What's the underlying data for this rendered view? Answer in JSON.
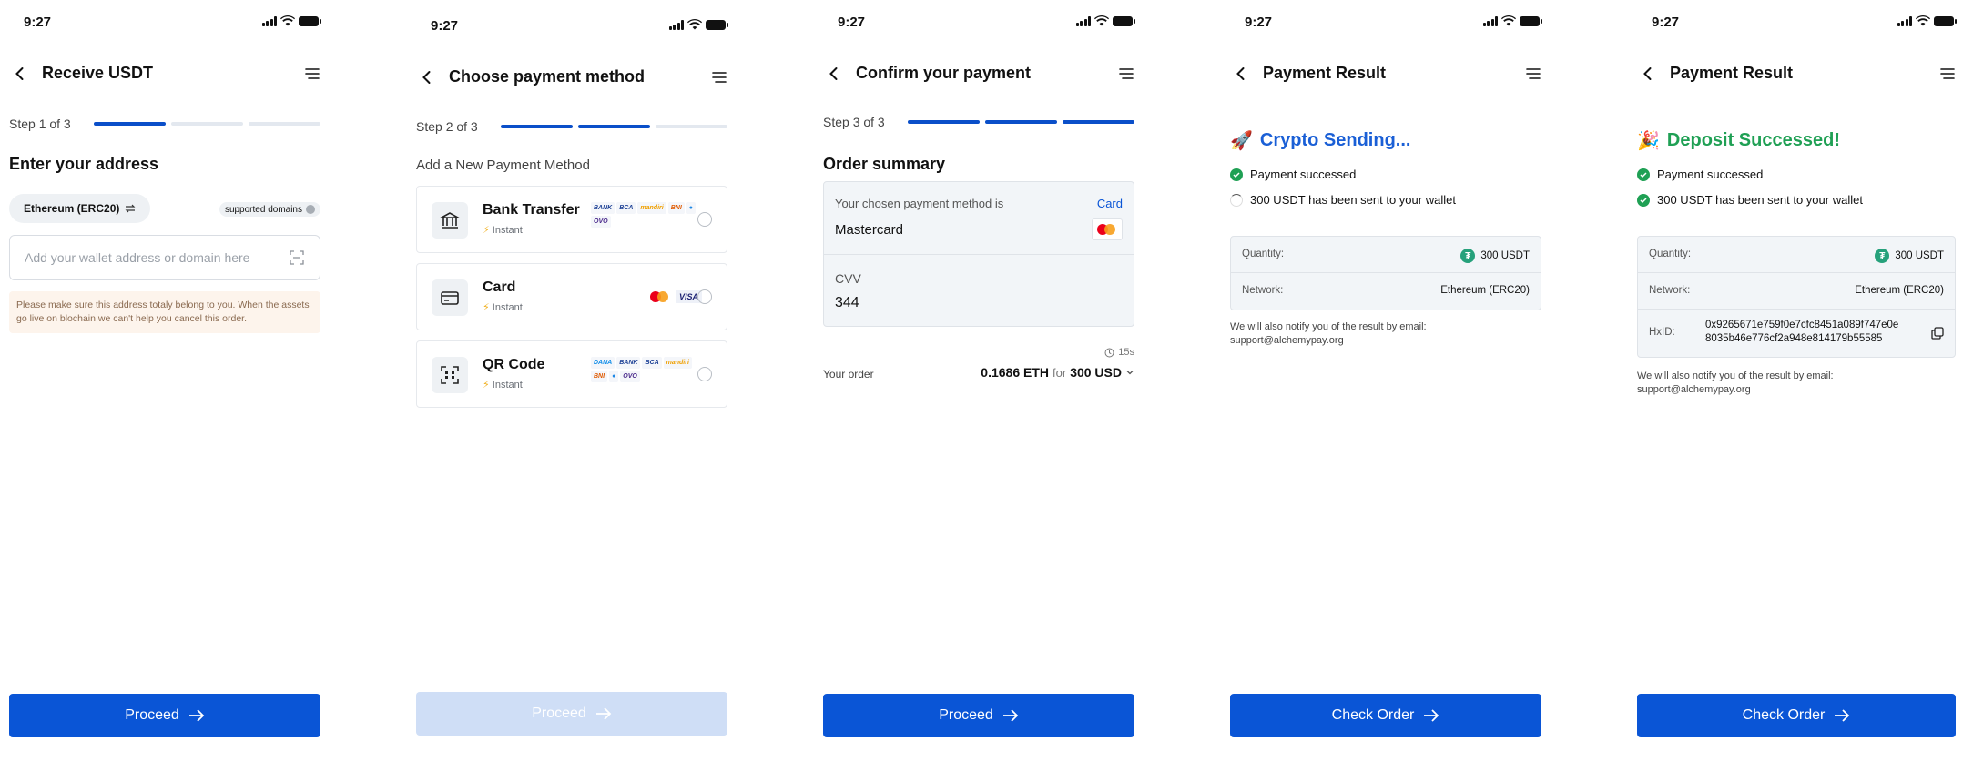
{
  "status_time": "9:27",
  "common": {
    "step_prefix": "Step",
    "proceed_label": "Proceed",
    "check_order_label": "Check Order",
    "quantity_label": "Quantity:",
    "quantity_value": "300 USDT",
    "network_label": "Network:",
    "network_value": "Ethereum (ERC20)",
    "notify_text": "We will also notify you of the result by email:",
    "notify_email": "support@alchemypay.org",
    "payment_success": "Payment successed",
    "sent_to_wallet": "300 USDT has been sent to your wallet"
  },
  "screen1": {
    "title": "Receive USDT",
    "step": "Step 1 of 3",
    "heading": "Enter your address",
    "network_chip": "Ethereum (ERC20)",
    "supported": "supported domains",
    "address_placeholder": "Add your wallet address or domain here",
    "warning": "Please make sure this address totaly belong to you. When the assets go live on blochain we can't help you cancel this order.",
    "proceed": "Proceed"
  },
  "screen2": {
    "title": "Choose payment method",
    "step": "Step 2 of 3",
    "subtitle": "Add a New Payment Method",
    "methods": [
      {
        "name": "Bank Transfer",
        "speed": "Instant",
        "logos": [
          "BANK",
          "BCA",
          "mandiri",
          "BNI",
          "●",
          "OVO"
        ]
      },
      {
        "name": "Card",
        "speed": "Instant",
        "logos": [
          "VISA"
        ]
      },
      {
        "name": "QR Code",
        "speed": "Instant",
        "logos": [
          "DANA",
          "BANK",
          "BCA",
          "mandiri",
          "BNI",
          "●",
          "OVO"
        ]
      }
    ],
    "proceed": "Proceed"
  },
  "screen3": {
    "title": "Confirm your payment",
    "step": "Step 3 of 3",
    "heading": "Order summary",
    "chosen_label": "Your chosen payment method is",
    "card_link": "Card",
    "card_name": "Mastercard",
    "cvv_label": "CVV",
    "cvv_value": "344",
    "timer": "15s",
    "order_label": "Your order",
    "order_eth": "0.1686 ETH",
    "order_for": "for",
    "order_usd": "300 USD",
    "proceed": "Proceed"
  },
  "screen4": {
    "title": "Payment Result",
    "result": "Crypto Sending...",
    "result_color": "#1a5fd6",
    "check_order": "Check Order"
  },
  "screen5": {
    "title": "Payment Result",
    "result": "Deposit Successed!",
    "result_color": "#1fa054",
    "txid_label": "HxID:",
    "txid_line1": "0x9265671e759f0e7cfc8451a089f747e0e",
    "txid_line2": "8035b46e776cf2a948e814179b55585",
    "check_order": "Check Order"
  },
  "colors": {
    "primary": "#0a55d6",
    "disabled": "#cfdef6",
    "success": "#1fa054"
  }
}
